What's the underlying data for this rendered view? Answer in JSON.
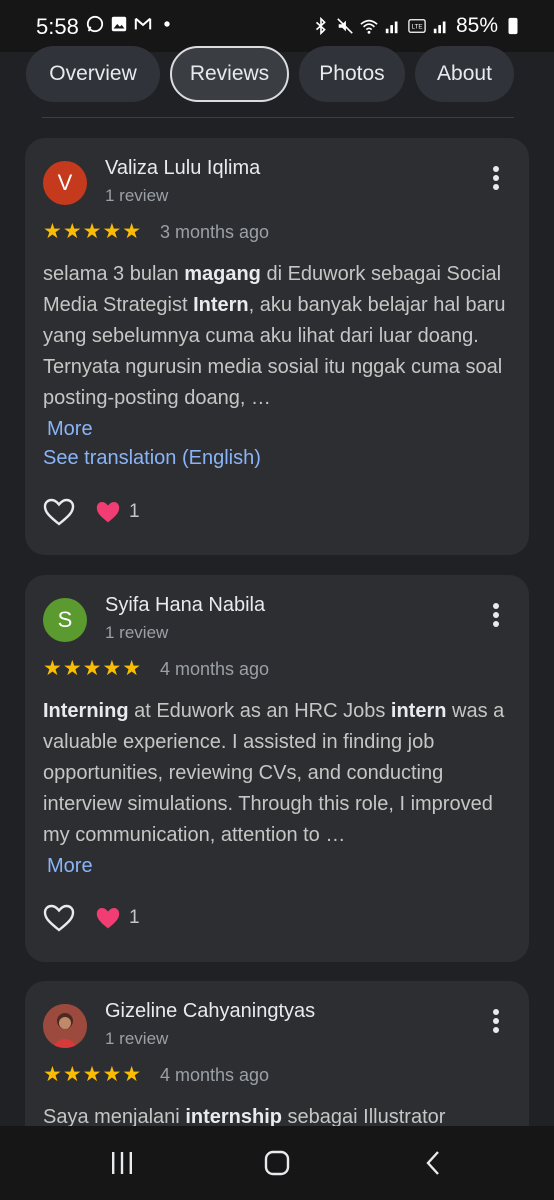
{
  "status": {
    "time": "5:58",
    "battery": "85%"
  },
  "tabs": [
    {
      "label": "Overview"
    },
    {
      "label": "Reviews"
    },
    {
      "label": "Photos"
    },
    {
      "label": "About"
    }
  ],
  "reviews": [
    {
      "initial": "V",
      "avatar_color": "#c5391d",
      "name": "Valiza Lulu Iqlima",
      "meta": "1 review",
      "stars": "★★★★★",
      "rating": 5,
      "time": "3 months ago",
      "text_parts": [
        "selama 3 bulan ",
        "magang",
        " di Eduwork sebagai Social Media Strategist ",
        "Intern",
        ", aku banyak belajar hal baru yang sebelumnya cuma aku lihat dari luar doang. Ternyata ngurusin media sosial itu nggak cuma soal posting-posting doang, …"
      ],
      "more": "More",
      "translation": "See translation (English)",
      "reaction_count": "1"
    },
    {
      "initial": "S",
      "avatar_color": "#5b9a2f",
      "name": "Syifa Hana Nabila",
      "meta": "1 review",
      "stars": "★★★★★",
      "rating": 5,
      "time": "4 months ago",
      "text_parts": [
        "Interning",
        " at Eduwork as an HRC Jobs ",
        "intern",
        " was a valuable experience. I assisted in finding job opportunities, reviewing CVs, and conducting interview simulations. Through this role, I improved my communication, attention to …"
      ],
      "more": "More",
      "reaction_count": "1"
    },
    {
      "name": "Gizeline Cahyaningtyas",
      "meta": "1 review",
      "stars": "★★★★★",
      "rating": 5,
      "time": "4 months ago",
      "text_parts": [
        "Saya menjalani ",
        "internship",
        " sebagai Illustrator"
      ]
    }
  ],
  "colors": {
    "star": "#fbbc04",
    "link": "#8ab4f8",
    "card": "#2d2e31",
    "background": "#202124"
  }
}
